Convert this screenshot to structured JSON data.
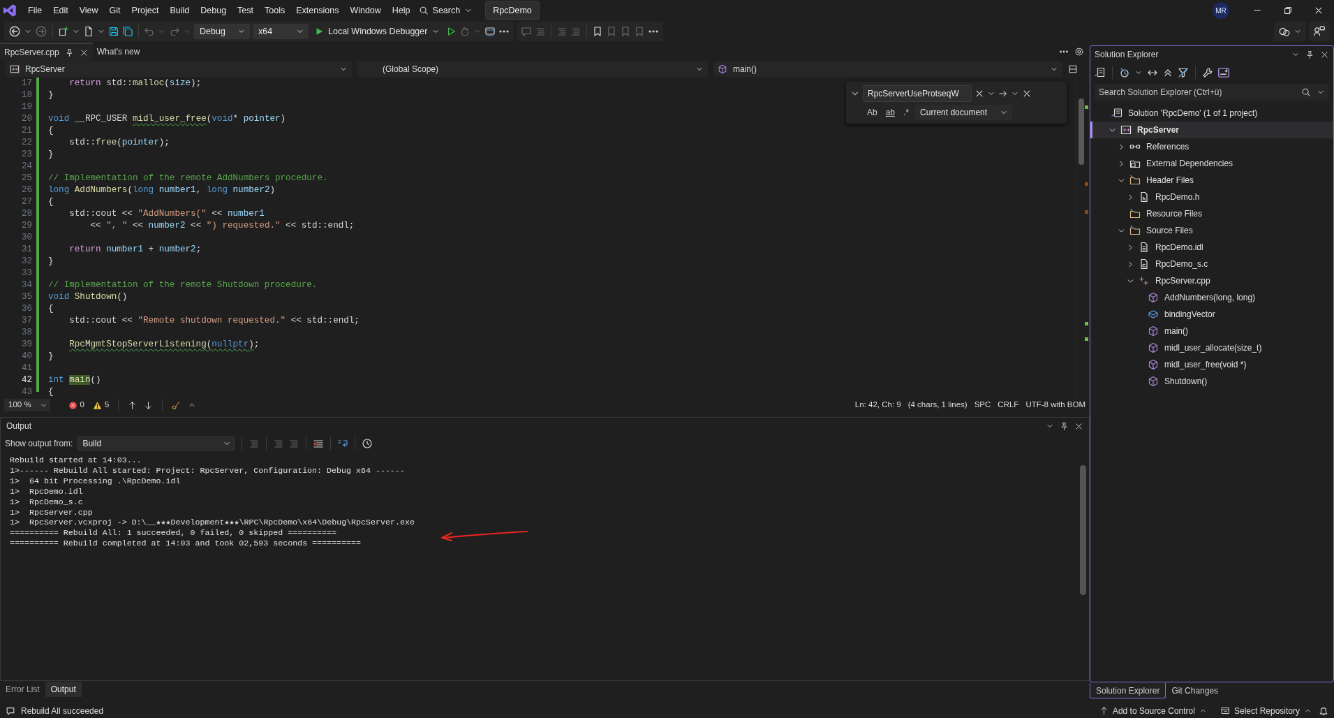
{
  "title_bar": {
    "menu": [
      "File",
      "Edit",
      "View",
      "Git",
      "Project",
      "Build",
      "Debug",
      "Test",
      "Tools",
      "Extensions",
      "Window",
      "Help"
    ],
    "search": "Search",
    "solution_name": "RpcDemo",
    "account_initials": "MR"
  },
  "toolbar": {
    "configuration": "Debug",
    "platform": "x64",
    "debug_target": "Local Windows Debugger"
  },
  "document_tabs": [
    {
      "label": "RpcServer.cpp",
      "selected": true
    },
    {
      "label": "What's new",
      "selected": false
    }
  ],
  "navigation_bar": {
    "project": "RpcServer",
    "scope": "(Global Scope)",
    "member": "main()"
  },
  "find": {
    "value": "RpcServerUseProtseqW",
    "match_case": "Ab",
    "whole_word": "ab",
    "regex": ".*",
    "scope": "Current document"
  },
  "code": {
    "lines": [
      {
        "number": "17",
        "current": false,
        "tokens": [
          {
            "kind": "control",
            "text": "    return"
          },
          {
            "kind": "text",
            "text": " std::"
          },
          {
            "kind": "function",
            "text": "malloc"
          },
          {
            "kind": "text",
            "text": "("
          },
          {
            "kind": "variable",
            "text": "size"
          },
          {
            "kind": "text",
            "text": ");"
          }
        ]
      },
      {
        "number": "18",
        "current": false,
        "tokens": [
          {
            "kind": "text",
            "text": "}"
          }
        ]
      },
      {
        "number": "19",
        "current": false
      },
      {
        "number": "20",
        "current": false,
        "tokens": [
          {
            "kind": "keyword",
            "text": "void"
          },
          {
            "kind": "text",
            "text": " __RPC_USER "
          },
          {
            "kind": "function-warning",
            "text": "midl_user_free"
          },
          {
            "kind": "text",
            "text": "("
          },
          {
            "kind": "keyword",
            "text": "void"
          },
          {
            "kind": "text",
            "text": "* "
          },
          {
            "kind": "variable",
            "text": "pointer"
          },
          {
            "kind": "text",
            "text": ")"
          }
        ]
      },
      {
        "number": "21",
        "current": false,
        "tokens": [
          {
            "kind": "text",
            "text": "{"
          }
        ]
      },
      {
        "number": "22",
        "current": false,
        "tokens": [
          {
            "kind": "text",
            "text": "    std::"
          },
          {
            "kind": "function",
            "text": "free"
          },
          {
            "kind": "text",
            "text": "("
          },
          {
            "kind": "variable",
            "text": "pointer"
          },
          {
            "kind": "text",
            "text": ");"
          }
        ]
      },
      {
        "number": "23",
        "current": false,
        "tokens": [
          {
            "kind": "text",
            "text": "}"
          }
        ]
      },
      {
        "number": "24",
        "current": false
      },
      {
        "number": "25",
        "current": false,
        "tokens": [
          {
            "kind": "comment",
            "text": "// Implementation of the remote AddNumbers procedure."
          }
        ]
      },
      {
        "number": "26",
        "current": false,
        "tokens": [
          {
            "kind": "keyword",
            "text": "long "
          },
          {
            "kind": "function",
            "text": "AddNumbers"
          },
          {
            "kind": "text",
            "text": "("
          },
          {
            "kind": "keyword",
            "text": "long "
          },
          {
            "kind": "variable",
            "text": "number1"
          },
          {
            "kind": "text",
            "text": ", "
          },
          {
            "kind": "keyword",
            "text": "long "
          },
          {
            "kind": "variable",
            "text": "number2"
          },
          {
            "kind": "text",
            "text": ")"
          }
        ]
      },
      {
        "number": "27",
        "current": false,
        "tokens": [
          {
            "kind": "text",
            "text": "{"
          }
        ]
      },
      {
        "number": "28",
        "current": false,
        "tokens": [
          {
            "kind": "text",
            "text": "    std::cout << "
          },
          {
            "kind": "string",
            "text": "\"AddNumbers(\""
          },
          {
            "kind": "text",
            "text": " << "
          },
          {
            "kind": "variable",
            "text": "number1"
          }
        ]
      },
      {
        "number": "29",
        "current": false,
        "tokens": [
          {
            "kind": "text",
            "text": "        << "
          },
          {
            "kind": "string",
            "text": "\", \""
          },
          {
            "kind": "text",
            "text": " << "
          },
          {
            "kind": "variable",
            "text": "number2"
          },
          {
            "kind": "text",
            "text": " << "
          },
          {
            "kind": "string",
            "text": "\") requested.\""
          },
          {
            "kind": "text",
            "text": " << std::endl;"
          }
        ]
      },
      {
        "number": "30",
        "current": false
      },
      {
        "number": "31",
        "current": false,
        "tokens": [
          {
            "kind": "control",
            "text": "    return "
          },
          {
            "kind": "variable",
            "text": "number1"
          },
          {
            "kind": "text",
            "text": " + "
          },
          {
            "kind": "variable",
            "text": "number2"
          },
          {
            "kind": "text",
            "text": ";"
          }
        ]
      },
      {
        "number": "32",
        "current": false,
        "tokens": [
          {
            "kind": "text",
            "text": "}"
          }
        ]
      },
      {
        "number": "33",
        "current": false
      },
      {
        "number": "34",
        "current": false,
        "tokens": [
          {
            "kind": "comment",
            "text": "// Implementation of the remote Shutdown procedure."
          }
        ]
      },
      {
        "number": "35",
        "current": false,
        "tokens": [
          {
            "kind": "keyword",
            "text": "void "
          },
          {
            "kind": "function",
            "text": "Shutdown"
          },
          {
            "kind": "text",
            "text": "()"
          }
        ]
      },
      {
        "number": "36",
        "current": false,
        "tokens": [
          {
            "kind": "text",
            "text": "{"
          }
        ]
      },
      {
        "number": "37",
        "current": false,
        "tokens": [
          {
            "kind": "text",
            "text": "    std::cout << "
          },
          {
            "kind": "string",
            "text": "\"Remote shutdown requested.\""
          },
          {
            "kind": "text",
            "text": " << std::endl;"
          }
        ]
      },
      {
        "number": "38",
        "current": false
      },
      {
        "number": "39",
        "current": false,
        "tokens": [
          {
            "kind": "indent-text",
            "text": "    RpcMgmtStopServerListening"
          },
          {
            "kind": "text-warning",
            "text": "("
          },
          {
            "kind": "keyword-warning",
            "text": "nullptr"
          },
          {
            "kind": "text-warning",
            "text": ")"
          },
          {
            "kind": "text",
            "text": ";"
          }
        ]
      },
      {
        "number": "40",
        "current": false,
        "tokens": [
          {
            "kind": "text",
            "text": "}"
          }
        ]
      },
      {
        "number": "41",
        "current": false
      },
      {
        "number": "42",
        "current": true,
        "tokens": [
          {
            "kind": "keyword",
            "text": "int "
          },
          {
            "kind": "highlight",
            "text": "main"
          },
          {
            "kind": "text",
            "text": "()"
          }
        ]
      },
      {
        "number": "43",
        "current": false,
        "tokens": [
          {
            "kind": "text",
            "text": "{"
          }
        ]
      }
    ]
  },
  "editor_status": {
    "zoom": "100 %",
    "errors": "0",
    "warnings": "5",
    "position": "Ln: 42, Ch: 9",
    "selection": "(4 chars, 1 lines)",
    "whitespace": "SPC",
    "line_endings": "CRLF",
    "encoding": "UTF-8 with BOM"
  },
  "output": {
    "title": "Output",
    "source_label": "Show output from:",
    "source": "Build",
    "lines": [
      "Rebuild started at 14:03...",
      "1>------ Rebuild All started: Project: RpcServer, Configuration: Debug x64 ------",
      "1>  64 bit Processing .\\RpcDemo.idl",
      "1>  RpcDemo.idl",
      "1>  RpcDemo_s.c",
      "1>  RpcServer.cpp",
      "1>  RpcServer.vcxproj -> D:\\__★★★Development★★★\\RPC\\RpcDemo\\x64\\Debug\\RpcServer.exe",
      "========== Rebuild All: 1 succeeded, 0 failed, 0 skipped ==========",
      "========== Rebuild completed at 14:03 and took 02,593 seconds =========="
    ],
    "annotations": [
      {
        "kind": "arrow"
      }
    ]
  },
  "bottom_tabs": [
    {
      "label": "Error List",
      "selected": false
    },
    {
      "label": "Output",
      "selected": true
    }
  ],
  "solution_explorer": {
    "title": "Solution Explorer",
    "search_placeholder": "Search Solution Explorer (Ctrl+ü)",
    "tree": [
      {
        "label": "Solution 'RpcDemo' (1 of 1 project)",
        "kind": "solution",
        "selected": false,
        "children": [
          {
            "label": "RpcServer",
            "kind": "project",
            "selected": true,
            "expanded": true,
            "children": [
              {
                "label": "References",
                "kind": "references",
                "selected": false,
                "expanded": false
              },
              {
                "label": "External Dependencies",
                "kind": "dependencies",
                "selected": false,
                "expanded": false
              },
              {
                "label": "Header Files",
                "kind": "folder",
                "selected": false,
                "expanded": true,
                "children": [
                  {
                    "label": "RpcDemo.h",
                    "kind": "header",
                    "selected": false,
                    "expanded": false
                  }
                ]
              },
              {
                "label": "Resource Files",
                "kind": "folder",
                "selected": false
              },
              {
                "label": "Source Files",
                "kind": "folder",
                "selected": false,
                "expanded": true,
                "children": [
                  {
                    "label": "RpcDemo.idl",
                    "kind": "file",
                    "selected": false,
                    "expanded": false
                  },
                  {
                    "label": "RpcDemo_s.c",
                    "kind": "source",
                    "selected": false,
                    "expanded": false
                  },
                  {
                    "label": "RpcServer.cpp",
                    "kind": "cpp",
                    "selected": false,
                    "expanded": true,
                    "children": [
                      {
                        "label": "AddNumbers(long, long)",
                        "kind": "function",
                        "selected": false
                      },
                      {
                        "label": "bindingVector",
                        "kind": "variable",
                        "selected": false
                      },
                      {
                        "label": "main()",
                        "kind": "function",
                        "selected": false
                      },
                      {
                        "label": "midl_user_allocate(size_t)",
                        "kind": "function",
                        "selected": false
                      },
                      {
                        "label": "midl_user_free(void *)",
                        "kind": "function",
                        "selected": false
                      },
                      {
                        "label": "Shutdown()",
                        "kind": "function",
                        "selected": false
                      }
                    ]
                  }
                ]
              }
            ]
          }
        ]
      }
    ]
  },
  "side_tabs": [
    {
      "label": "Solution Explorer",
      "selected": true
    },
    {
      "label": "Git Changes",
      "selected": false
    }
  ],
  "status_bar": {
    "message": "Rebuild All succeeded",
    "source_control": "Add to Source Control",
    "repository": "Select Repository"
  }
}
